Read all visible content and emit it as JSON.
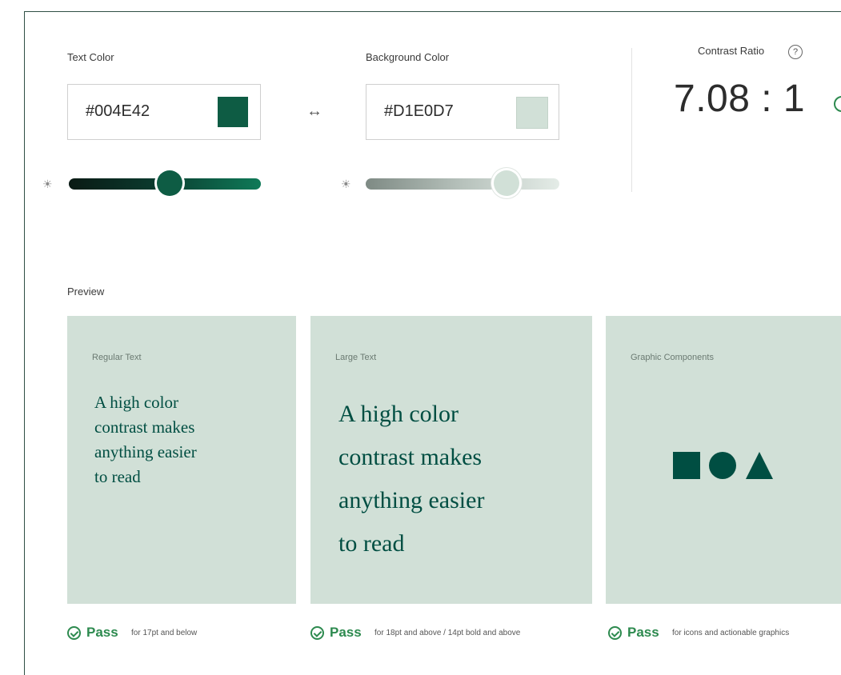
{
  "text_color": {
    "label": "Text Color",
    "value": "#004E42",
    "swatch": "#0e5c44"
  },
  "background_color": {
    "label": "Background Color",
    "value": "#D1E0D7",
    "swatch": "#d1e0d7"
  },
  "swap_icon": "swap-horizontal-icon",
  "contrast": {
    "label": "Contrast Ratio",
    "help_glyph": "?",
    "value": "7.08 : 1"
  },
  "preview": {
    "label": "Preview",
    "cards": [
      {
        "title": "Regular Text",
        "text": [
          "A high color",
          "contrast makes",
          "anything easier",
          "to read"
        ]
      },
      {
        "title": "Large Text",
        "text": [
          "A high color",
          "contrast makes",
          "anything easier",
          "to read"
        ]
      },
      {
        "title": "Graphic Components",
        "shapes": [
          "square",
          "circle",
          "triangle"
        ]
      }
    ]
  },
  "results": [
    {
      "status": "Pass",
      "note": "for 17pt and below"
    },
    {
      "status": "Pass",
      "note": "for 18pt and above / 14pt bold and above"
    },
    {
      "status": "Pass",
      "note": "for icons and actionable graphics"
    }
  ],
  "colors": {
    "foreground": "#004e42",
    "background": "#d1e0d7",
    "pass": "#2d8a4f"
  }
}
